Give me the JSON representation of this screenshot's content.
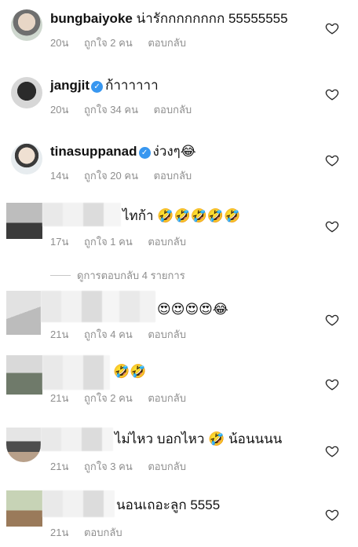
{
  "comments": [
    {
      "username": "bungbaiyoke",
      "verified": false,
      "text": "น่ารักกกกกกกก 55555555",
      "time": "20น",
      "likes": "ถูกใจ 2 คน",
      "reply": "ตอบกลับ"
    },
    {
      "username": "jangjit",
      "verified": true,
      "text": "ก้าาาาาา",
      "time": "20น",
      "likes": "ถูกใจ 34 คน",
      "reply": "ตอบกลับ"
    },
    {
      "username": "tinasuppanad",
      "verified": true,
      "text": "ง่วงๆ😂",
      "time": "14น",
      "likes": "ถูกใจ 20 คน",
      "reply": "ตอบกลับ"
    },
    {
      "username": "",
      "verified": false,
      "text": "ไทก้า 🤣🤣🤣🤣🤣",
      "time": "17น",
      "likes": "ถูกใจ 1 คน",
      "reply": "ตอบกลับ"
    },
    {
      "username": "",
      "verified": false,
      "text": "😍😍😍😍😂",
      "time": "21น",
      "likes": "ถูกใจ 4 คน",
      "reply": "ตอบกลับ"
    },
    {
      "username": "",
      "verified": false,
      "text": "🤣🤣",
      "time": "21น",
      "likes": "ถูกใจ 2 คน",
      "reply": "ตอบกลับ"
    },
    {
      "username": "",
      "verified": false,
      "text": "ไม่ไหว บอกไหว 🤣 น้อนนนน",
      "time": "21น",
      "likes": "ถูกใจ 3 คน",
      "reply": "ตอบกลับ"
    },
    {
      "username": "",
      "verified": false,
      "text": "นอนเถอะลูก 5555",
      "time": "21น",
      "likes": "",
      "reply": "ตอบกลับ"
    }
  ],
  "view_replies": "ดูการตอบกลับ 4 รายการ",
  "icons": {
    "heart": "heart-outline-icon",
    "verified": "verified-badge-icon"
  },
  "colors": {
    "meta": "#8e8e8e",
    "verified": "#3897f0"
  }
}
